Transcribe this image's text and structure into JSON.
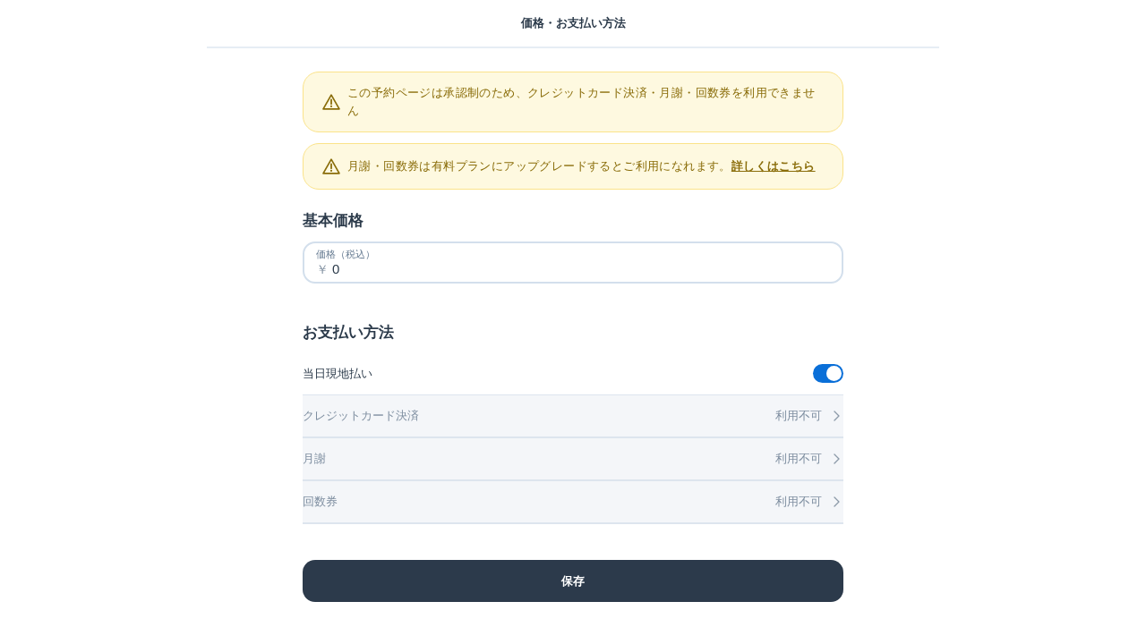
{
  "header": {
    "title": "価格・お支払い方法"
  },
  "alerts": [
    {
      "text": "この予約ページは承認制のため、クレジットカード決済・月謝・回数券を利用できません"
    },
    {
      "text": "月謝・回数券は有料プランにアップグレードするとご利用になれます。",
      "link": "詳しくはこちら"
    }
  ],
  "basic_price": {
    "heading": "基本価格",
    "price_field": {
      "label": "価格（税込）",
      "prefix": "￥",
      "value": "0"
    }
  },
  "payment_methods": {
    "heading": "お支払い方法",
    "items": [
      {
        "kind": "toggle",
        "label": "当日現地払い",
        "on": true,
        "disabled": false
      },
      {
        "kind": "link",
        "label": "クレジットカード決済",
        "status": "利用不可",
        "disabled": true
      },
      {
        "kind": "link",
        "label": "月謝",
        "status": "利用不可",
        "disabled": true
      },
      {
        "kind": "link",
        "label": "回数券",
        "status": "利用不可",
        "disabled": true
      }
    ]
  },
  "save_button": {
    "label": "保存"
  }
}
